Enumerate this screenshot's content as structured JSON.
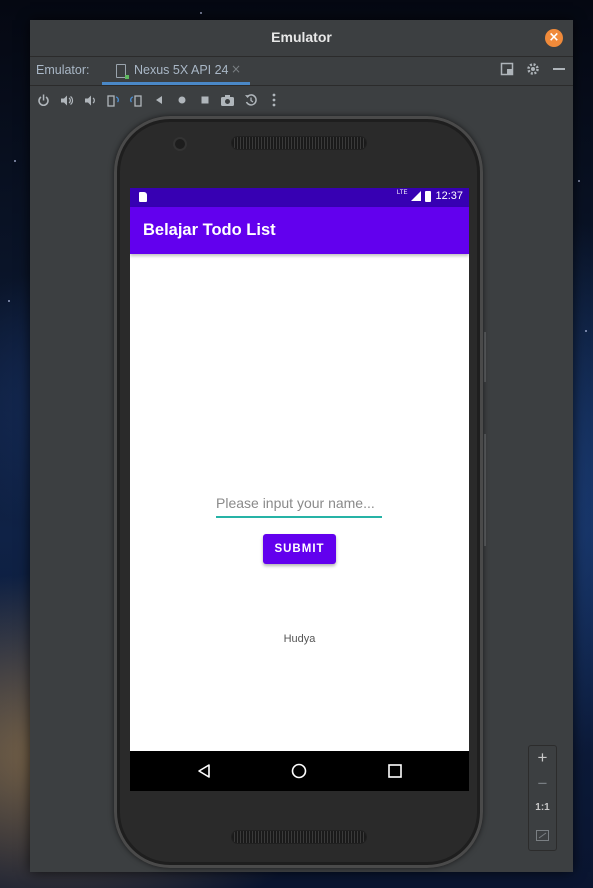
{
  "window": {
    "title": "Emulator",
    "close_icon": "close-icon"
  },
  "tabbar": {
    "label": "Emulator:",
    "device_tab": "Nexus 5X API 24",
    "tab_close": "×"
  },
  "toolbar": {
    "icons": [
      "power-icon",
      "volume-up-icon",
      "volume-down-icon",
      "rotate-left-icon",
      "rotate-right-icon",
      "back-icon",
      "home-icon",
      "overview-icon",
      "screenshot-icon",
      "snapshot-icon",
      "more-icon"
    ]
  },
  "device": {
    "status_time": "12:37",
    "status_network": "LTE",
    "app_title": "Belajar Todo List",
    "input_placeholder": "Please input your name...",
    "submit_label": "SUBMIT",
    "result_text": "Hudya"
  },
  "zoom": {
    "zoom_in": "+",
    "zoom_out": "−",
    "actual_size": "1:1"
  },
  "colors": {
    "status_bar": "#3700b3",
    "app_bar": "#6200ee",
    "input_underline": "#26b3a6",
    "close_button": "#f08a3a",
    "tab_underline": "#4a88c7"
  }
}
